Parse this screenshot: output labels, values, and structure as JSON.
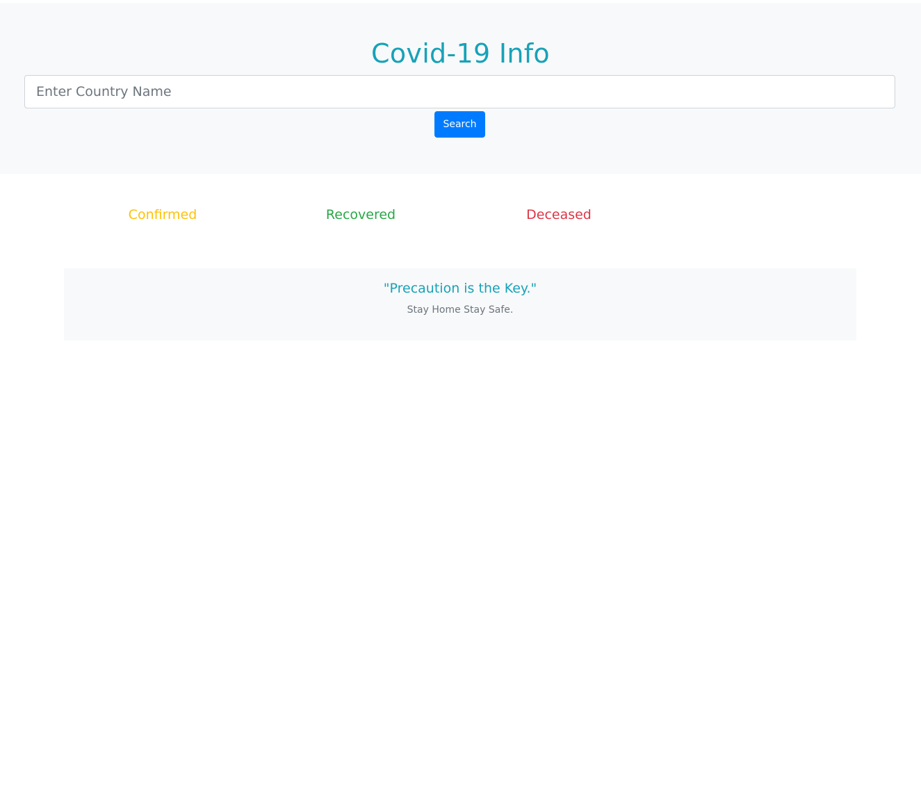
{
  "header": {
    "title": "Covid-19 Info"
  },
  "search": {
    "placeholder": "Enter Country Name",
    "value": "",
    "button_label": "Search"
  },
  "stats": {
    "confirmed_label": "Confirmed",
    "recovered_label": "Recovered",
    "deceased_label": "Deceased"
  },
  "quote": {
    "text": "\"Precaution is the Key.\"",
    "subtext": "Stay Home Stay Safe."
  },
  "colors": {
    "title": "#17a2b8",
    "confirmed": "#ffc107",
    "recovered": "#28a745",
    "deceased": "#dc3545",
    "button": "#007bff",
    "panel_bg": "#f8f9fa"
  }
}
